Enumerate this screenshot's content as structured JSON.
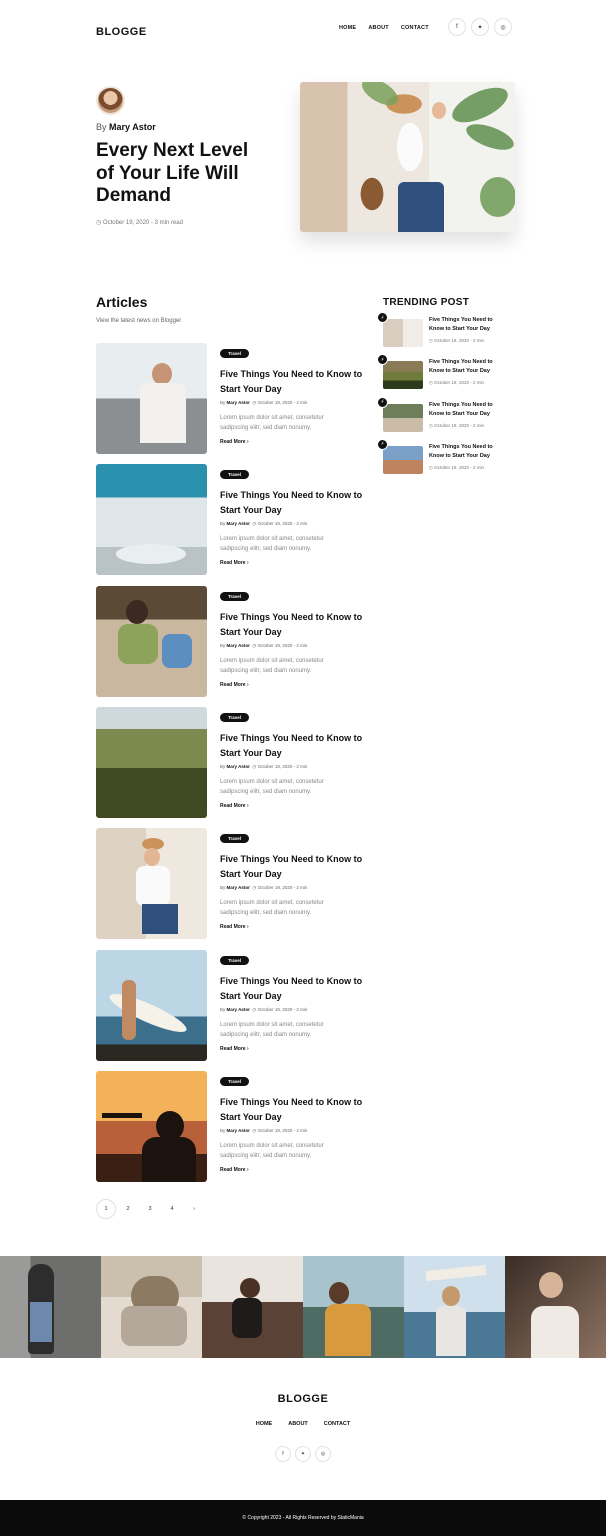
{
  "header": {
    "logo": "BLOGGE",
    "nav": [
      "HOME",
      "ABOUT",
      "CONTACT"
    ],
    "socials": [
      {
        "icon": "facebook-icon",
        "glyph": "f"
      },
      {
        "icon": "twitter-icon",
        "glyph": "✦"
      },
      {
        "icon": "instagram-icon",
        "glyph": "◎"
      }
    ]
  },
  "hero": {
    "by": "By",
    "author": "Mary Astor",
    "title": "Every Next Level of Your Life Will Demand",
    "meta": "◷ October 19, 2020 - 3 min read"
  },
  "articles_section": {
    "title": "Articles",
    "subtitle": "View the latest news on Blogger"
  },
  "articles": [
    {
      "tag": "Travel",
      "title": "Five Things You Need to Know to Start Your Day",
      "by": "By",
      "author": "Mary Astor",
      "meta": "◷ October 19, 2020 - 2 min",
      "excerpt": "Lorem ipsum dolor sit amet, consetetur sadipscing elitr, sed diam nonumy.",
      "read_more": "Read More ›"
    },
    {
      "tag": "Travel",
      "title": "Five Things You Need to Know to Start Your Day",
      "by": "By",
      "author": "Mary Astor",
      "meta": "◷ October 19, 2020 - 2 min",
      "excerpt": "Lorem ipsum dolor sit amet, consetetur sadipscing elitr, sed diam nonumy.",
      "read_more": "Read More ›"
    },
    {
      "tag": "Travel",
      "title": "Five Things You Need to Know to Start Your Day",
      "by": "By",
      "author": "Mary Astor",
      "meta": "◷ October 19, 2020 - 2 min",
      "excerpt": "Lorem ipsum dolor sit amet, consetetur sadipscing elitr, sed diam nonumy.",
      "read_more": "Read More ›"
    },
    {
      "tag": "Travel",
      "title": "Five Things You Need to Know to Start Your Day",
      "by": "By",
      "author": "Mary Astor",
      "meta": "◷ October 19, 2020 - 2 min",
      "excerpt": "Lorem ipsum dolor sit amet, consetetur sadipscing elitr, sed diam nonumy.",
      "read_more": "Read More ›"
    },
    {
      "tag": "Travel",
      "title": "Five Things You Need to Know to Start Your Day",
      "by": "By",
      "author": "Mary Astor",
      "meta": "◷ October 19, 2020 - 2 min",
      "excerpt": "Lorem ipsum dolor sit amet, consetetur sadipscing elitr, sed diam nonumy.",
      "read_more": "Read More ›"
    },
    {
      "tag": "Travel",
      "title": "Five Things You Need to Know to Start Your Day",
      "by": "By",
      "author": "Mary Astor",
      "meta": "◷ October 19, 2020 - 2 min",
      "excerpt": "Lorem ipsum dolor sit amet, consetetur sadipscing elitr, sed diam nonumy.",
      "read_more": "Read More ›"
    },
    {
      "tag": "Travel",
      "title": "Five Things You Need to Know to Start Your Day",
      "by": "By",
      "author": "Mary Astor",
      "meta": "◷ October 19, 2020 - 2 min",
      "excerpt": "Lorem ipsum dolor sit amet, consetetur sadipscing elitr, sed diam nonumy.",
      "read_more": "Read More ›"
    }
  ],
  "trending": {
    "title": "TRENDING POST",
    "badge_icon": "lightning-icon",
    "badge_glyph": "⚡",
    "items": [
      {
        "title": "Five Things You Need to Know to Start Your Day",
        "meta": "◷ October 19, 2020 - 2 min"
      },
      {
        "title": "Five Things You Need to Know to Start Your Day",
        "meta": "◷ October 19, 2020 - 2 min"
      },
      {
        "title": "Five Things You Need to Know to Start Your Day",
        "meta": "◷ October 19, 2020 - 2 min"
      },
      {
        "title": "Five Things You Need to Know to Start Your Day",
        "meta": "◷ October 19, 2020 - 2 min"
      }
    ]
  },
  "pagination": {
    "pages": [
      "1",
      "2",
      "3",
      "4"
    ],
    "next": "›",
    "active": "1"
  },
  "footer": {
    "logo": "BLOGGE",
    "nav": [
      "HOME",
      "ABOUT",
      "CONTACT"
    ],
    "socials": [
      {
        "icon": "facebook-icon",
        "glyph": "f"
      },
      {
        "icon": "twitter-icon",
        "glyph": "✦"
      },
      {
        "icon": "instagram-icon",
        "glyph": "◎"
      }
    ],
    "copyright": "© Copyright 2023 - All Rights Reserved by StaticMania"
  },
  "colors": {
    "text": "#111111",
    "muted": "#888888",
    "bottom_bar": "#0b0b0b",
    "tag_bg": "#111111"
  }
}
